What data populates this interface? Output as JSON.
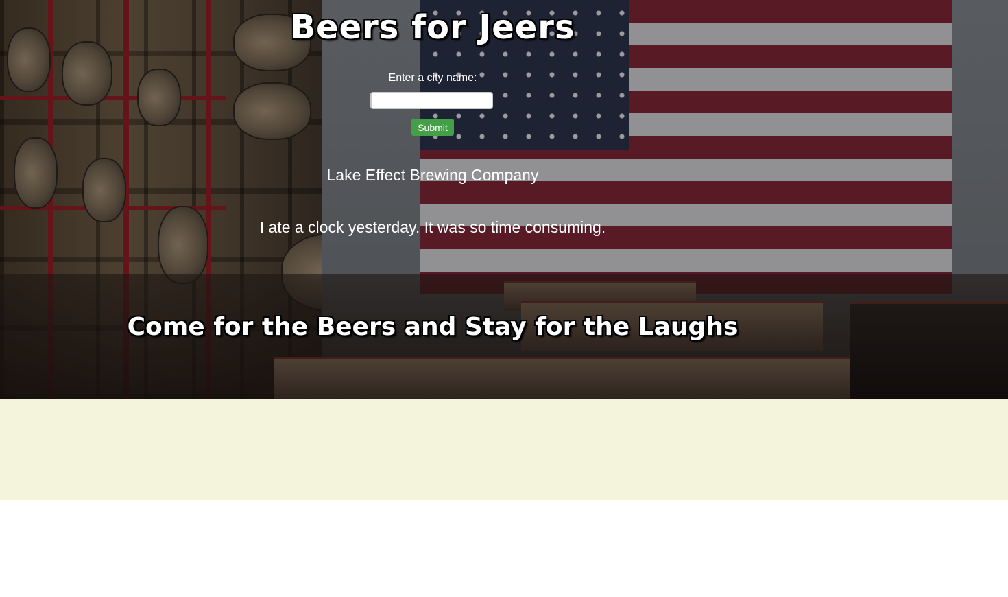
{
  "header": {
    "title": "Beers for Jeers"
  },
  "search": {
    "label": "Enter a city name:",
    "value": "",
    "placeholder": "",
    "submit_label": "Submit"
  },
  "result": {
    "brewery_name": "Lake Effect Brewing Company",
    "joke": "I ate a clock yesterday. It was so time consuming."
  },
  "tagline": "Come for the Beers and Stay for the Laughs",
  "colors": {
    "submit_button": "#43a047",
    "lower_band": "#f4f3dc",
    "text": "#ffffff"
  }
}
